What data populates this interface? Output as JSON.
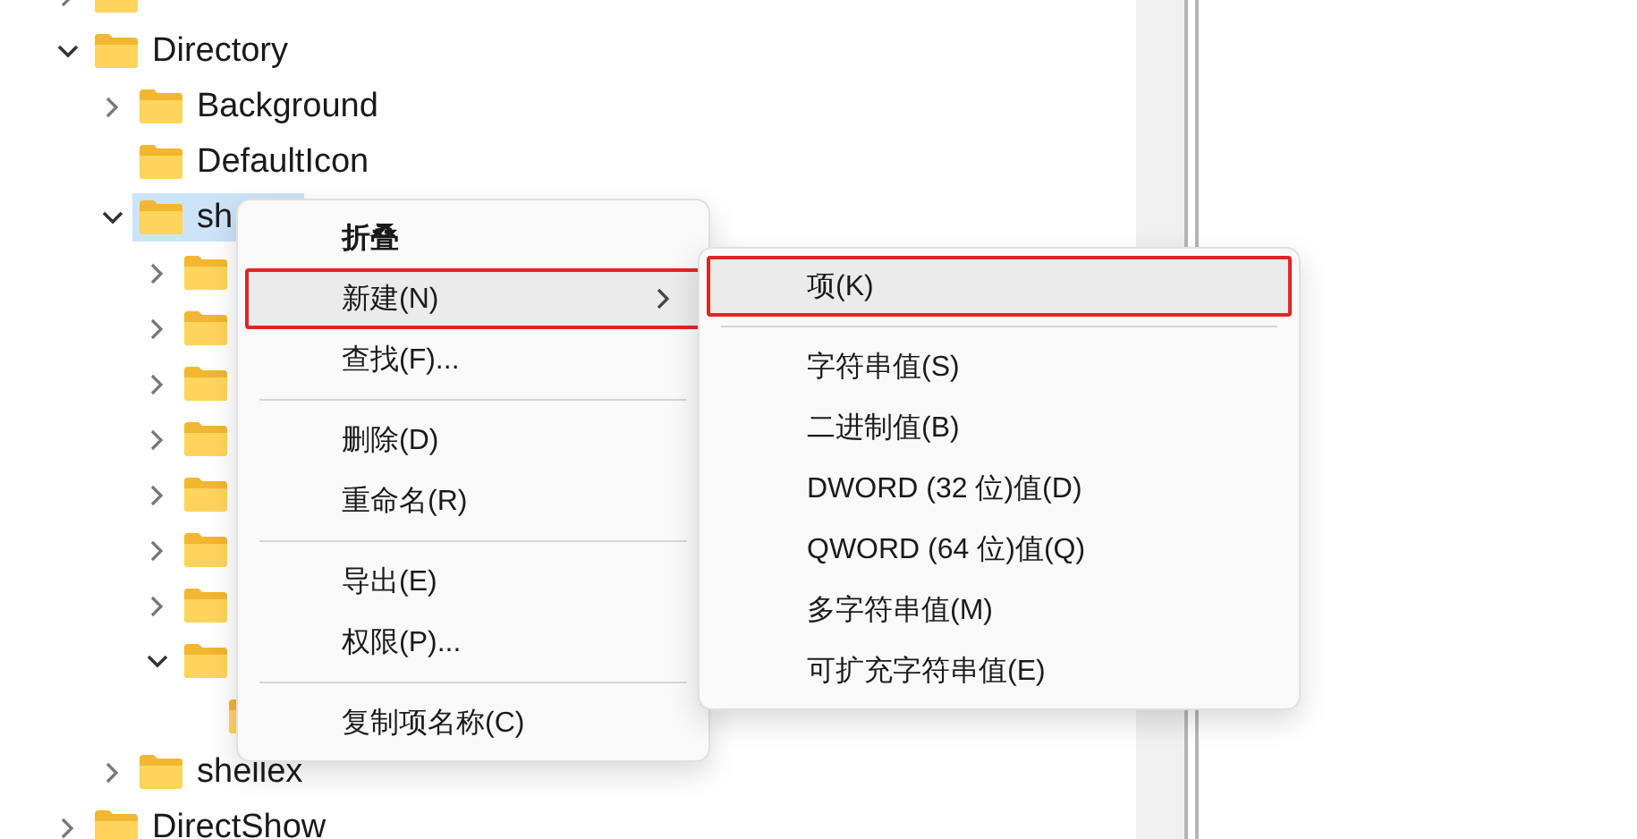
{
  "tree": [
    {
      "expanded": false,
      "selected": false
    },
    {
      "label": "Directory",
      "expanded": true,
      "selected": false,
      "children": [
        {
          "label": "Background",
          "expanded": false,
          "selected": false
        },
        {
          "label": "DefaultIcon",
          "selected": false
        },
        {
          "label": "sh",
          "expanded": true,
          "selected": true,
          "children": [
            {
              "expanded": false,
              "selected": false
            },
            {
              "expanded": false,
              "selected": false
            },
            {
              "expanded": false,
              "selected": false
            },
            {
              "expanded": false,
              "selected": false
            },
            {
              "expanded": false,
              "selected": false
            },
            {
              "expanded": false,
              "selected": false
            },
            {
              "expanded": false,
              "selected": false
            },
            {
              "expanded": true,
              "selected": false,
              "children": [
                {
                  "selected": false
                }
              ]
            }
          ]
        },
        {
          "label": "shellex",
          "expanded": false,
          "selected": false
        }
      ]
    },
    {
      "label": "DirectShow",
      "expanded": false,
      "selected": false
    }
  ],
  "context_menu": {
    "items": [
      {
        "kind": "item",
        "label": "折叠",
        "bold": true,
        "selected": false,
        "annotated": false,
        "submenu": false
      },
      {
        "kind": "item",
        "label": "新建(N)",
        "bold": false,
        "selected": true,
        "annotated": true,
        "submenu": true
      },
      {
        "kind": "item",
        "label": "查找(F)...",
        "bold": false,
        "selected": false,
        "annotated": false,
        "submenu": false
      },
      {
        "kind": "separator"
      },
      {
        "kind": "item",
        "label": "删除(D)",
        "bold": false,
        "selected": false,
        "annotated": false,
        "submenu": false
      },
      {
        "kind": "item",
        "label": "重命名(R)",
        "bold": false,
        "selected": false,
        "annotated": false,
        "submenu": false
      },
      {
        "kind": "separator"
      },
      {
        "kind": "item",
        "label": "导出(E)",
        "bold": false,
        "selected": false,
        "annotated": false,
        "submenu": false
      },
      {
        "kind": "item",
        "label": "权限(P)...",
        "bold": false,
        "selected": false,
        "annotated": false,
        "submenu": false
      },
      {
        "kind": "separator"
      },
      {
        "kind": "item",
        "label": "复制项名称(C)",
        "bold": false,
        "selected": false,
        "annotated": false,
        "submenu": false
      }
    ]
  },
  "submenu": {
    "items": [
      {
        "kind": "item",
        "label": "项(K)",
        "selected": true,
        "annotated": true
      },
      {
        "kind": "separator"
      },
      {
        "kind": "item",
        "label": "字符串值(S)",
        "selected": false,
        "annotated": false
      },
      {
        "kind": "item",
        "label": "二进制值(B)",
        "selected": false,
        "annotated": false
      },
      {
        "kind": "item",
        "label": "DWORD (32 位)值(D)",
        "selected": false,
        "annotated": false
      },
      {
        "kind": "item",
        "label": "QWORD (64 位)值(Q)",
        "selected": false,
        "annotated": false
      },
      {
        "kind": "item",
        "label": "多字符串值(M)",
        "selected": false,
        "annotated": false
      },
      {
        "kind": "item",
        "label": "可扩充字符串值(E)",
        "selected": false,
        "annotated": false
      }
    ]
  }
}
